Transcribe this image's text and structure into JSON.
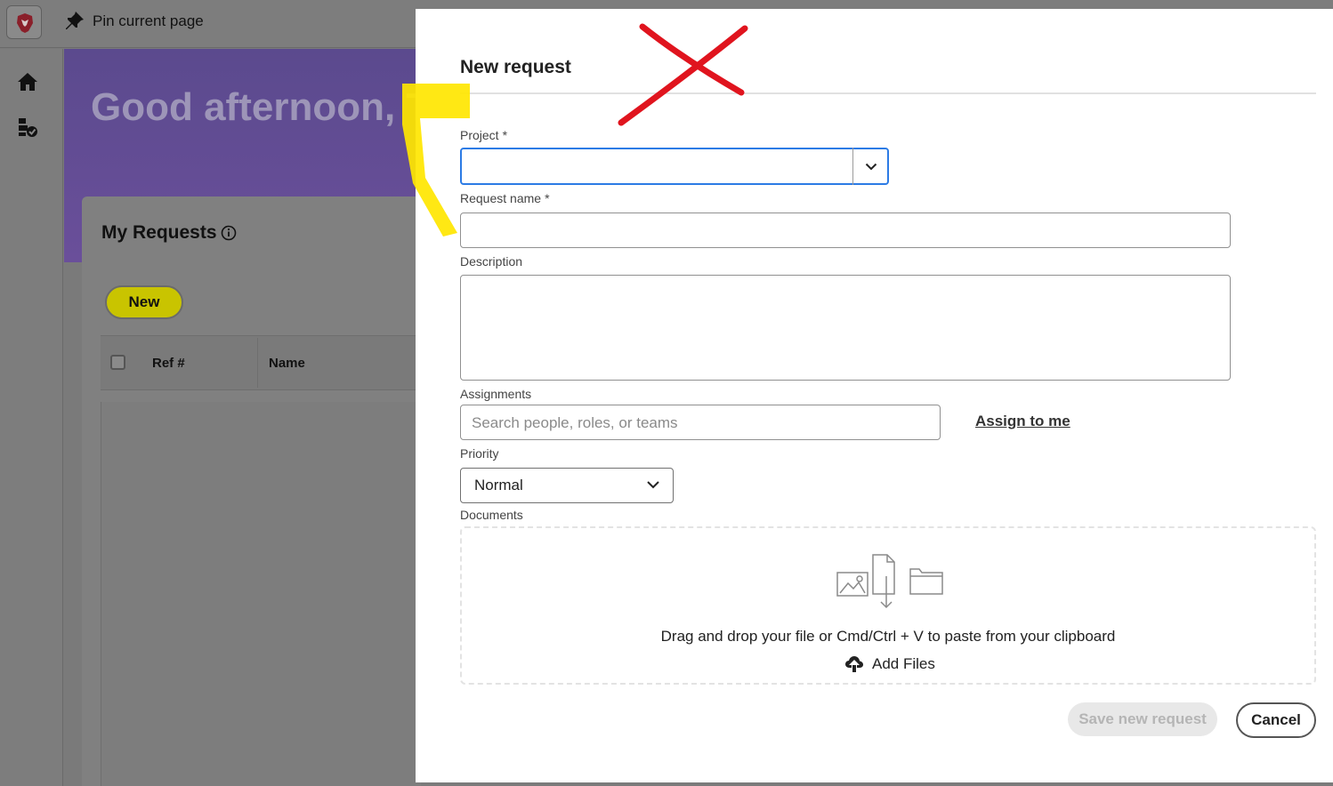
{
  "topbar": {
    "pin_label": "Pin current page"
  },
  "banner": {
    "greeting": "Good afternoon, Te"
  },
  "requests_panel": {
    "title": "My Requests",
    "new_button": "New",
    "columns": [
      "Ref #",
      "Name"
    ]
  },
  "dialog": {
    "title": "New request",
    "required_marker": "*",
    "project": {
      "label": "Project",
      "value": ""
    },
    "request_name": {
      "label": "Request name",
      "value": ""
    },
    "description": {
      "label": "Description",
      "value": ""
    },
    "assignments": {
      "label": "Assignments",
      "placeholder": "Search people, roles, or teams",
      "assign_to_me": "Assign to me"
    },
    "priority": {
      "label": "Priority",
      "value": "Normal"
    },
    "documents": {
      "label": "Documents",
      "drop_text": "Drag and drop your file or Cmd/Ctrl + V to paste from your clipboard",
      "add_files": "Add Files"
    },
    "save_button": "Save new request",
    "cancel_button": "Cancel"
  },
  "colors": {
    "accent_focus": "#2c7be5",
    "highlight_yellow": "#ffe600",
    "annotation_red": "#e0141e"
  }
}
